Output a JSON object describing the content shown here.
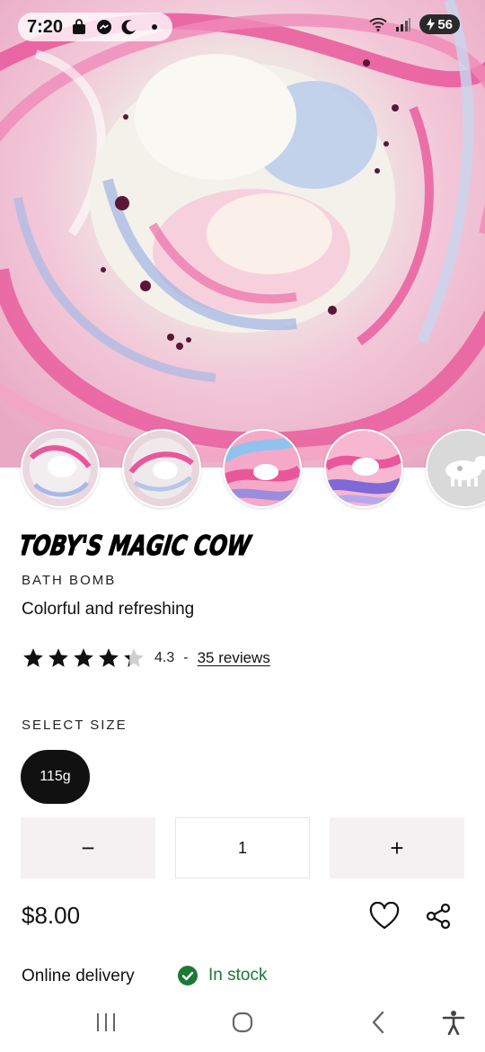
{
  "status_bar": {
    "time": "7:20",
    "battery_level": "56",
    "icons": [
      "shopping-bag-icon",
      "messenger-icon",
      "do-not-disturb-moon-icon",
      "notification-dot-icon",
      "wifi-icon",
      "signal-icon",
      "battery-charging-icon"
    ]
  },
  "hero": {
    "image": "swirled pink, white and blue bath bomb photo"
  },
  "thumbnails": [
    {
      "name": "thumbnail-1",
      "image": "bath bomb top view"
    },
    {
      "name": "thumbnail-2",
      "image": "bath bomb side view"
    },
    {
      "name": "thumbnail-3",
      "image": "bath bomb rainbow swirl"
    },
    {
      "name": "thumbnail-4",
      "image": "bath bomb purple swirl"
    },
    {
      "name": "thumbnail-5",
      "image": "white cow figure"
    }
  ],
  "product": {
    "title": "TOBY'S MAGIC COW",
    "category": "BATH BOMB",
    "tagline": "Colorful and refreshing",
    "rating": 4.3,
    "rating_text": "4.3",
    "rating_separator": "-",
    "reviews_link": "35 reviews",
    "price": "$8.00"
  },
  "size": {
    "label": "SELECT SIZE",
    "options": [
      "115g"
    ],
    "selected": "115g"
  },
  "quantity": {
    "minus_label": "−",
    "value": "1",
    "plus_label": "+"
  },
  "actions": {
    "wishlist_icon": "heart-outline-icon",
    "share_icon": "share-icon"
  },
  "availability": {
    "delivery_label": "Online delivery",
    "stock_text": "In stock",
    "stock_color": "#1a7a36"
  },
  "navbar": {
    "icons": [
      "recent-apps-icon",
      "home-icon",
      "back-icon",
      "accessibility-icon"
    ]
  },
  "colors": {
    "accent_pink": "#e9579a",
    "dark": "#111111",
    "qty_button_bg": "#f5f1f2"
  }
}
